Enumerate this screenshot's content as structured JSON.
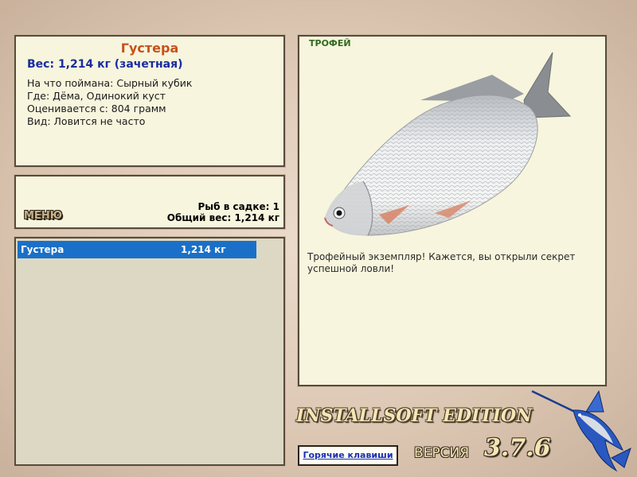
{
  "info": {
    "fish_name": "Густера",
    "weight_line": "Вес: 1,214 кг (зачетная)",
    "caught_on": "На что поймана: Сырный кубик",
    "location": "Где: Дёма, Одинокий куст",
    "scored_from": "Оценивается с: 804 грамм",
    "kind": "Вид: Ловится не часто"
  },
  "menu": {
    "label": "МЕНЮ",
    "fish_in_keepnet": "Рыб в садке: 1",
    "total_weight": "Общий вес: 1,214 кг"
  },
  "catch_list": [
    {
      "name": "Густера",
      "weight": "1,214 кг"
    }
  ],
  "trophy": {
    "title": "ТРОФЕЙ",
    "message": "Трофейный экземпляр! Кажется, вы открыли секрет успешной ловли!",
    "image_icon": "white-bream-fish"
  },
  "footer": {
    "edition": "INSTALLSOFT EDITION",
    "hotkeys_label": "Горячие клавиши",
    "version_label": "ВЕРСИЯ",
    "version_number": "3.7.6",
    "logo_icon": "marlin-icon"
  },
  "colors": {
    "panel_bg": "#f7f5dd",
    "panel_border": "#5a4a3a",
    "fish_name": "#c8501a",
    "weight": "#1a2ca0",
    "selection": "#1a70c8",
    "trophy_title": "#2f6a1e"
  }
}
